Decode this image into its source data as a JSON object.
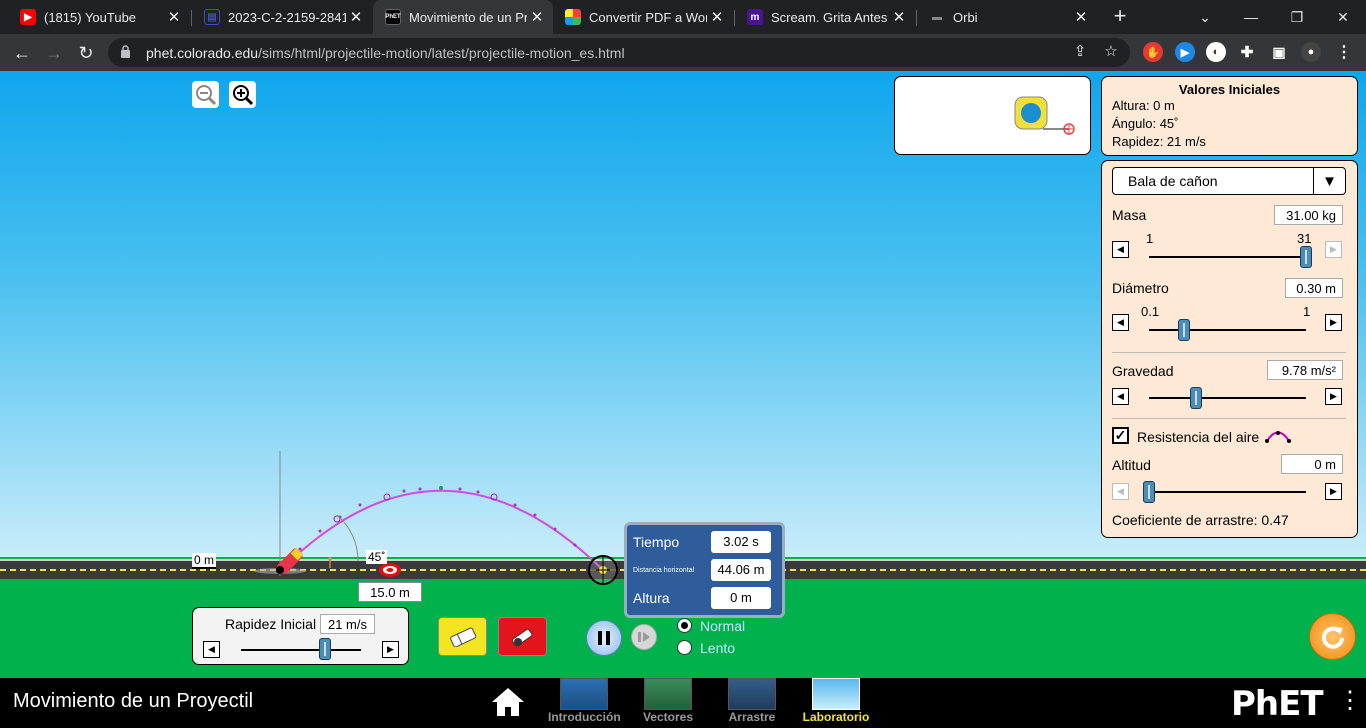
{
  "browser": {
    "tabs": [
      {
        "title": "(1815) YouTube",
        "favicon": "youtube-icon",
        "color": "#ff0000"
      },
      {
        "title": "2023-C-2-2159-2841-",
        "favicon": "document-icon",
        "color": "#1a237e"
      },
      {
        "title": "Movimiento de un Pro",
        "favicon": "phet-icon",
        "color": "#000000",
        "active": true
      },
      {
        "title": "Convertir PDF a Word",
        "favicon": "grid-icon",
        "color": "#e91e63"
      },
      {
        "title": "Scream. Grita Antes de",
        "favicon": "m-icon",
        "color": "#6a1b9a"
      },
      {
        "title": "Orbi",
        "favicon": "book-icon",
        "color": "#555555"
      }
    ],
    "url_host": "phet.colorado.edu",
    "url_path": "/sims/html/projectile-motion/latest/projectile-motion_es.html"
  },
  "zoom": {
    "out_label": "−",
    "in_label": "+"
  },
  "initial_values": {
    "title": "Valores Iniciales",
    "height": "Altura: 0 m",
    "angle": "Ángulo: 45˚",
    "speed": "Rapidez: 21 m/s"
  },
  "controls": {
    "projectile": "Bala de cañon",
    "mass_label": "Masa",
    "mass_value": "31.00 kg",
    "mass_min": "1",
    "mass_max": "31",
    "mass_fraction": 1.0,
    "diameter_label": "Diámetro",
    "diameter_value": "0.30 m",
    "diameter_min": "0.1",
    "diameter_max": "1",
    "diameter_fraction": 0.22,
    "gravity_label": "Gravedad",
    "gravity_value": "9.78 m/s²",
    "gravity_fraction": 0.3,
    "air_resistance_label": "Resistencia del aire",
    "air_resistance_checked": true,
    "altitude_label": "Altitud",
    "altitude_value": "0 m",
    "altitude_fraction": 0.0,
    "drag_label": "Coeficiente de arrastre: 0.47"
  },
  "scene": {
    "height_label": "0 m",
    "angle_label": "45˚",
    "target_distance": "15.0 m"
  },
  "launch_speed": {
    "label": "Rapidez Inicial",
    "value": "21 m/s",
    "fraction": 0.7
  },
  "readout": {
    "time_label": "Tiempo",
    "time_value": "3.02 s",
    "distance_label": "Distancia horizontal",
    "distance_value": "44.06 m",
    "height_label": "Altura",
    "height_value": "0 m"
  },
  "playback": {
    "normal_label": "Normal",
    "slow_label": "Lento",
    "selected": "Normal"
  },
  "navbar": {
    "title": "Movimiento de un Proyectil",
    "screens": [
      "Introducción",
      "Vectores",
      "Arrastre",
      "Laboratorio"
    ],
    "active": "Laboratorio",
    "logo": "PhET"
  }
}
